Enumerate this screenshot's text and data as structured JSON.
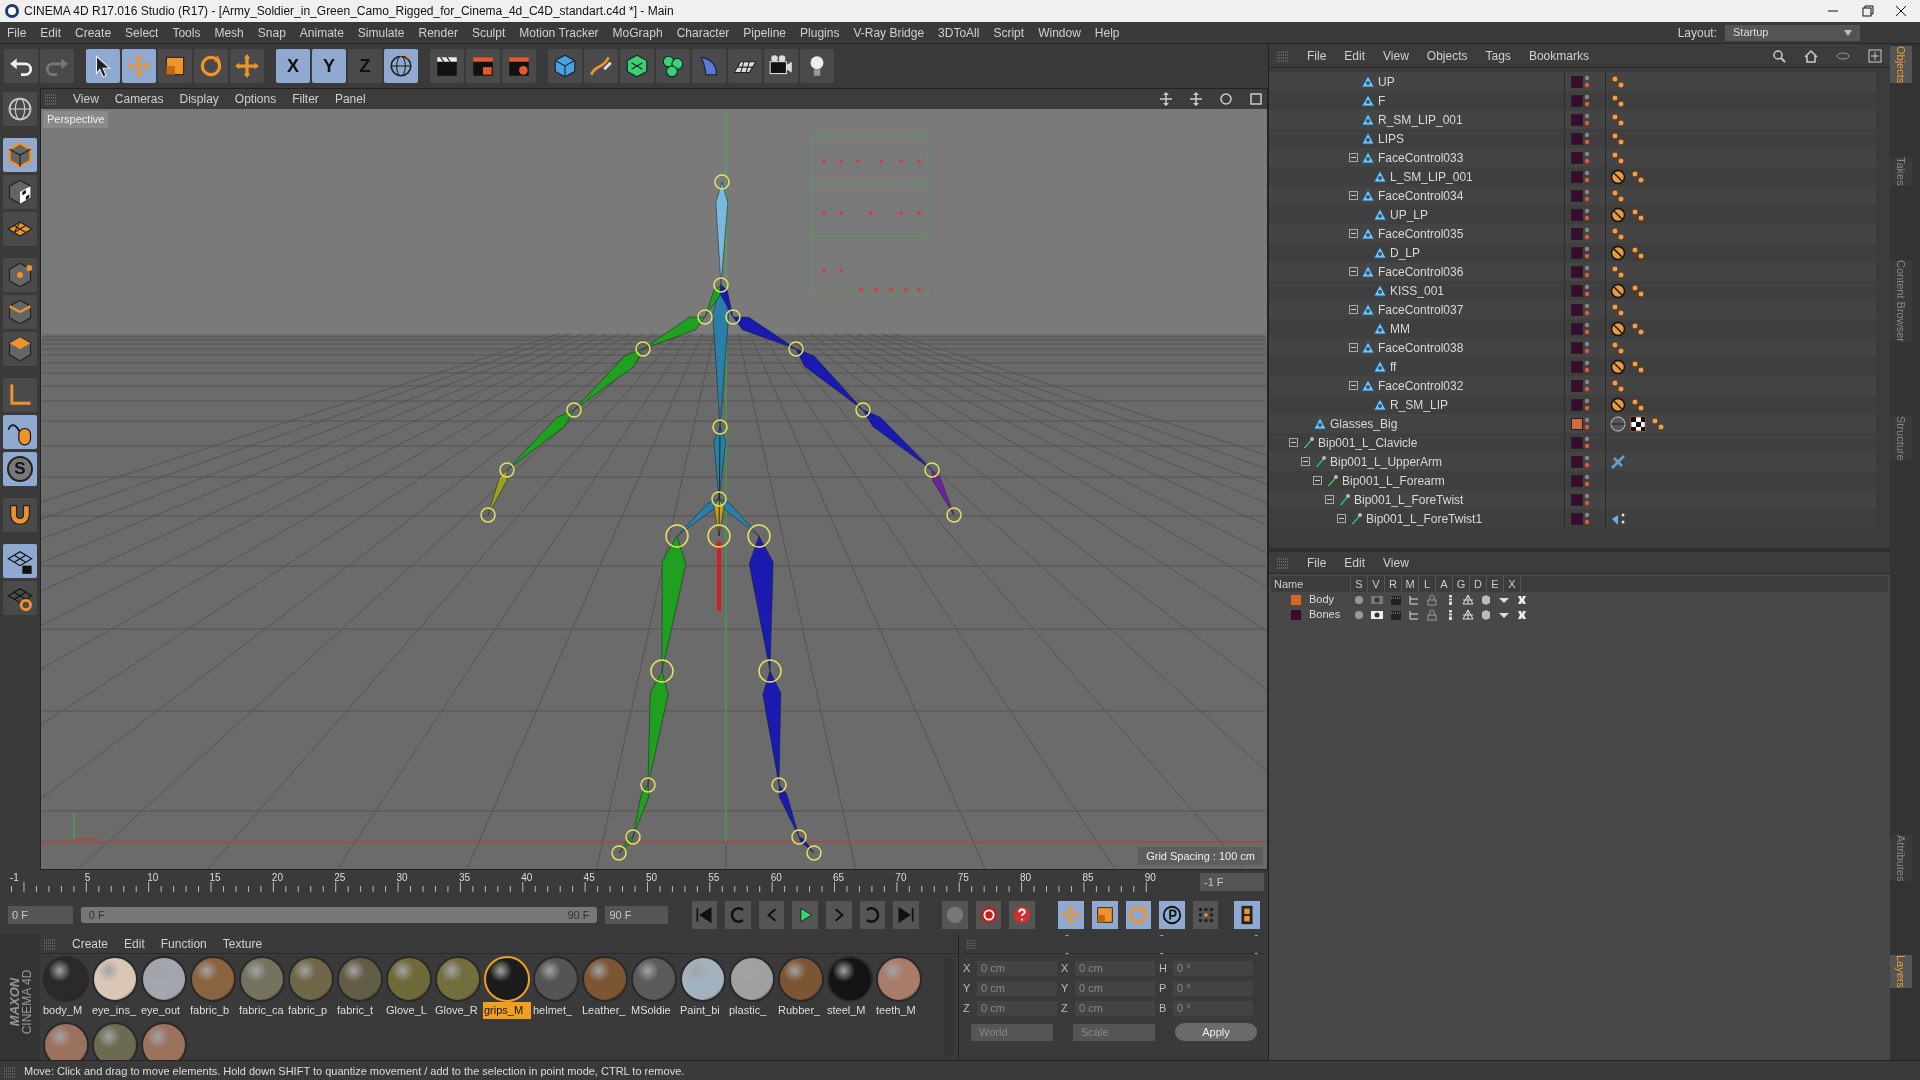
{
  "window": {
    "title": "CINEMA 4D R17.016 Studio (R17) - [Army_Soldier_in_Green_Camo_Rigged_for_Cinema_4d_C4D_standart.c4d *] - Main"
  },
  "menu_bar": {
    "items": [
      "File",
      "Edit",
      "Create",
      "Select",
      "Tools",
      "Mesh",
      "Snap",
      "Animate",
      "Simulate",
      "Render",
      "Sculpt",
      "Motion Tracker",
      "MoGraph",
      "Character",
      "Pipeline",
      "Plugins",
      "V-Ray Bridge",
      "3DToAll",
      "Script",
      "Window",
      "Help"
    ],
    "layout_label": "Layout:",
    "layout_value": "Startup"
  },
  "toolbar": {
    "tools": [
      {
        "kind": "undo",
        "active": false
      },
      {
        "kind": "redo",
        "active": false
      },
      {
        "kind": "select",
        "active": true
      },
      {
        "kind": "move",
        "active": true
      },
      {
        "kind": "scale",
        "active": false
      },
      {
        "kind": "rotate",
        "active": false
      },
      {
        "kind": "transform",
        "active": false
      },
      {
        "kind": "axis",
        "label": "X",
        "active": true
      },
      {
        "kind": "axis",
        "label": "Y",
        "active": true
      },
      {
        "kind": "axis",
        "label": "Z",
        "active": false
      },
      {
        "kind": "coords",
        "active": true
      },
      {
        "kind": "renderview",
        "active": false
      },
      {
        "kind": "render",
        "active": false
      },
      {
        "kind": "rendersettings",
        "active": false
      },
      {
        "kind": "cube",
        "active": false
      },
      {
        "kind": "pen",
        "active": false
      },
      {
        "kind": "subdivision",
        "active": false
      },
      {
        "kind": "cloner",
        "active": false
      },
      {
        "kind": "deformer",
        "active": false
      },
      {
        "kind": "floor",
        "active": false
      },
      {
        "kind": "camera",
        "active": false
      },
      {
        "kind": "light",
        "active": false
      }
    ]
  },
  "left_tools": [
    {
      "kind": "globe",
      "active": false
    },
    {
      "kind": "model",
      "active": true
    },
    {
      "kind": "texture",
      "active": false
    },
    {
      "kind": "workplane",
      "active": false
    },
    {
      "kind": "points",
      "active": false
    },
    {
      "kind": "edges",
      "active": false
    },
    {
      "kind": "polygons",
      "active": false
    },
    {
      "kind": "axis",
      "active": false
    },
    {
      "kind": "tweak",
      "active": true
    },
    {
      "kind": "letter",
      "label": "S",
      "active": true
    },
    {
      "kind": "magnet",
      "active": false
    },
    {
      "kind": "gridlock",
      "active": true
    },
    {
      "kind": "gridrotate",
      "active": false
    }
  ],
  "viewport": {
    "menu": [
      "View",
      "Cameras",
      "Display",
      "Options",
      "Filter",
      "Panel"
    ],
    "camera": "Perspective",
    "grid_spacing": "Grid Spacing : 100 cm"
  },
  "timeline": {
    "ticks": [
      "-1",
      "5",
      "10",
      "15",
      "20",
      "25",
      "30",
      "35",
      "40",
      "45",
      "50",
      "55",
      "60",
      "65",
      "70",
      "75",
      "80",
      "85",
      "90"
    ],
    "current_frame": "-1 F",
    "start_field": "0 F",
    "range_start": "0 F",
    "range_end": "90 F",
    "range_slider": {
      "level": 1
    },
    "end_field": "90 F"
  },
  "materials": {
    "menu": [
      "Create",
      "Edit",
      "Function",
      "Texture"
    ],
    "items": [
      {
        "name": "body_M",
        "color": "#2a2a2a",
        "selected": false
      },
      {
        "name": "eye_ins_",
        "color": "#d9c6b4",
        "selected": false
      },
      {
        "name": "eye_out",
        "color": "#a4a6ae",
        "selected": false
      },
      {
        "name": "fabric_b",
        "color": "#8a6440",
        "selected": false
      },
      {
        "name": "fabric_ca",
        "color": "#75735e",
        "selected": false
      },
      {
        "name": "fabric_p",
        "color": "#706648",
        "selected": false
      },
      {
        "name": "fabric_t",
        "color": "#635c47",
        "selected": false
      },
      {
        "name": "Glove_L",
        "color": "#6f6a3a",
        "selected": false
      },
      {
        "name": "Glove_R",
        "color": "#736e3e",
        "selected": false
      },
      {
        "name": "grips_M",
        "color": "#1c1c1c",
        "selected": true
      },
      {
        "name": "helmet_",
        "color": "#545454",
        "selected": false
      },
      {
        "name": "Leather_",
        "color": "#7c5634",
        "selected": false
      },
      {
        "name": "MSoldie",
        "color": "#5a5a5a",
        "selected": false
      },
      {
        "name": "Paint_bi",
        "color": "#a3b2bf",
        "selected": false
      },
      {
        "name": "plastic_",
        "color": "#a0a0a0",
        "selected": false
      },
      {
        "name": "Rubber_",
        "color": "#7c5634",
        "selected": false
      },
      {
        "name": "steel_M",
        "color": "#141414",
        "selected": false
      },
      {
        "name": "teeth_M",
        "color": "#a87c68",
        "selected": false
      },
      {
        "color": "#9c725f",
        "selected": false
      },
      {
        "color": "#6c6b52",
        "selected": false
      },
      {
        "color": "#9c725f",
        "selected": false
      }
    ]
  },
  "logo": {
    "brand": "MAXON",
    "product": "CINEMA 4D"
  },
  "coordinates": {
    "headers": [
      "--",
      "--",
      "--"
    ],
    "rows": [
      {
        "axis": "X",
        "position": "0 cm",
        "size_axis": "X",
        "size": "0 cm",
        "rot_axis": "H",
        "rotation": "0 °"
      },
      {
        "axis": "Y",
        "position": "0 cm",
        "size_axis": "Y",
        "size": "0 cm",
        "rot_axis": "P",
        "rotation": "0 °"
      },
      {
        "axis": "Z",
        "position": "0 cm",
        "size_axis": "Z",
        "size": "0 cm",
        "rot_axis": "B",
        "rotation": "0 °"
      }
    ],
    "mode": "World",
    "size_mode": "Scale",
    "apply": "Apply"
  },
  "object_manager": {
    "menu": [
      "File",
      "Edit",
      "View",
      "Objects",
      "Tags",
      "Bookmarks"
    ],
    "objects": [
      {
        "children": [
          {
            "children": [
              {
                "children": [
                  {
                    "children": [
                      {
                        "children": [
                          {
                            "name": "UP",
                            "kind": "joint",
                            "color": "#3a0b2e",
                            "tags": [
                              {
                                "kind": "weights"
                              }
                            ]
                          },
                          {
                            "name": "F",
                            "kind": "joint",
                            "color": "#3a0b2e",
                            "tags": [
                              {
                                "kind": "weights"
                              }
                            ]
                          },
                          {
                            "name": "R_SM_LIP_001",
                            "kind": "joint",
                            "color": "#3a0b2e",
                            "tags": [
                              {
                                "kind": "weights"
                              }
                            ]
                          },
                          {
                            "name": "LIPS",
                            "kind": "joint",
                            "color": "#3a0b2e",
                            "tags": [
                              {
                                "kind": "weights"
                              }
                            ]
                          },
                          {
                            "name": "FaceControl033",
                            "kind": "joint",
                            "color": "#3a0b2e",
                            "tags": [
                              {
                                "kind": "weights"
                              }
                            ],
                            "expanded": true,
                            "children": [
                              {
                                "name": "L_SM_LIP_001",
                                "kind": "joint",
                                "color": "#3a0b2e",
                                "tags": [
                                  {
                                    "kind": "constraint"
                                  },
                                  {
                                    "kind": "weights"
                                  }
                                ]
                              }
                            ]
                          },
                          {
                            "name": "FaceControl034",
                            "kind": "joint",
                            "color": "#3a0b2e",
                            "tags": [
                              {
                                "kind": "weights"
                              }
                            ],
                            "expanded": true,
                            "children": [
                              {
                                "name": "UP_LP",
                                "kind": "joint",
                                "color": "#3a0b2e",
                                "tags": [
                                  {
                                    "kind": "constraint"
                                  },
                                  {
                                    "kind": "weights"
                                  }
                                ]
                              }
                            ]
                          },
                          {
                            "name": "FaceControl035",
                            "kind": "joint",
                            "color": "#3a0b2e",
                            "tags": [
                              {
                                "kind": "weights"
                              }
                            ],
                            "expanded": true,
                            "children": [
                              {
                                "name": "D_LP",
                                "kind": "joint",
                                "color": "#3a0b2e",
                                "tags": [
                                  {
                                    "kind": "constraint"
                                  },
                                  {
                                    "kind": "weights"
                                  }
                                ]
                              }
                            ]
                          },
                          {
                            "name": "FaceControl036",
                            "kind": "joint",
                            "color": "#3a0b2e",
                            "tags": [
                              {
                                "kind": "weights"
                              }
                            ],
                            "expanded": true,
                            "children": [
                              {
                                "name": "KISS_001",
                                "kind": "joint",
                                "color": "#3a0b2e",
                                "tags": [
                                  {
                                    "kind": "constraint"
                                  },
                                  {
                                    "kind": "weights"
                                  }
                                ]
                              }
                            ]
                          },
                          {
                            "name": "FaceControl037",
                            "kind": "joint",
                            "color": "#3a0b2e",
                            "tags": [
                              {
                                "kind": "weights"
                              }
                            ],
                            "expanded": true,
                            "children": [
                              {
                                "name": "MM",
                                "kind": "joint",
                                "color": "#3a0b2e",
                                "tags": [
                                  {
                                    "kind": "constraint"
                                  },
                                  {
                                    "kind": "weights"
                                  }
                                ]
                              }
                            ]
                          },
                          {
                            "name": "FaceControl038",
                            "kind": "joint",
                            "color": "#3a0b2e",
                            "tags": [
                              {
                                "kind": "weights"
                              }
                            ],
                            "expanded": true,
                            "children": [
                              {
                                "name": "ff",
                                "kind": "joint",
                                "color": "#3a0b2e",
                                "tags": [
                                  {
                                    "kind": "constraint"
                                  },
                                  {
                                    "kind": "weights"
                                  }
                                ]
                              }
                            ]
                          },
                          {
                            "name": "FaceControl032",
                            "kind": "joint",
                            "color": "#3a0b2e",
                            "tags": [
                              {
                                "kind": "weights"
                              }
                            ],
                            "expanded": true,
                            "children": [
                              {
                                "name": "R_SM_LIP",
                                "kind": "joint",
                                "color": "#3a0b2e",
                                "tags": [
                                  {
                                    "kind": "constraint"
                                  },
                                  {
                                    "kind": "weights"
                                  }
                                ]
                              }
                            ]
                          }
                        ]
                      }
                    ]
                  }
                ]
              }
            ]
          },
          {
            "name": "Glasses_Big",
            "kind": "joint",
            "color": "#d2693c",
            "tags": [
              {
                "kind": "material"
              },
              {
                "kind": "texture"
              },
              {
                "kind": "weights"
              }
            ]
          }
        ]
      },
      {
        "name": "Bip001_L_Clavicle",
        "kind": "bone",
        "color": "#3a0b2e",
        "expanded": true,
        "children": [
          {
            "name": "Bip001_L_UpperArm",
            "kind": "bone",
            "color": "#3a0b2e",
            "tags": [
              {
                "kind": "ik"
              }
            ],
            "expanded": true,
            "children": [
              {
                "name": "Bip001_L_Forearm",
                "kind": "bone",
                "color": "#3a0b2e",
                "expanded": true,
                "children": [
                  {
                    "name": "Bip001_L_ForeTwist",
                    "kind": "bone",
                    "color": "#3a0b2e",
                    "expanded": true,
                    "children": [
                      {
                        "name": "Bip001_L_ForeTwist1",
                        "kind": "bone",
                        "color": "#3a0b2e",
                        "tags": [
                          {
                            "kind": "pose"
                          }
                        ],
                        "expanded": true
                      }
                    ]
                  }
                ]
              }
            ]
          }
        ]
      }
    ]
  },
  "layers": {
    "menu": [
      "File",
      "Edit",
      "View"
    ],
    "columns": [
      "Name",
      "S",
      "V",
      "R",
      "M",
      "L",
      "A",
      "G",
      "D",
      "E",
      "X"
    ],
    "rows": [
      {
        "name": "Body",
        "color": "#d2691e",
        "editor_visible": false
      },
      {
        "name": "Bones",
        "color": "#3a0b2e",
        "editor_visible": true
      }
    ]
  },
  "side_tabs": {
    "upper": [
      {
        "label": "Objects",
        "selected": true
      },
      {
        "label": "Takes",
        "selected": false
      },
      {
        "label": "Content Browser",
        "selected": false
      },
      {
        "label": "Structure",
        "selected": false
      }
    ],
    "lower": [
      {
        "label": "Attributes",
        "selected": false
      },
      {
        "label": "Layers",
        "selected": true
      }
    ]
  },
  "status_bar": {
    "text": "Move: Click and drag to move elements. Hold down SHIFT to quantize movement / add to the selection in point mode, CTRL to remove."
  }
}
